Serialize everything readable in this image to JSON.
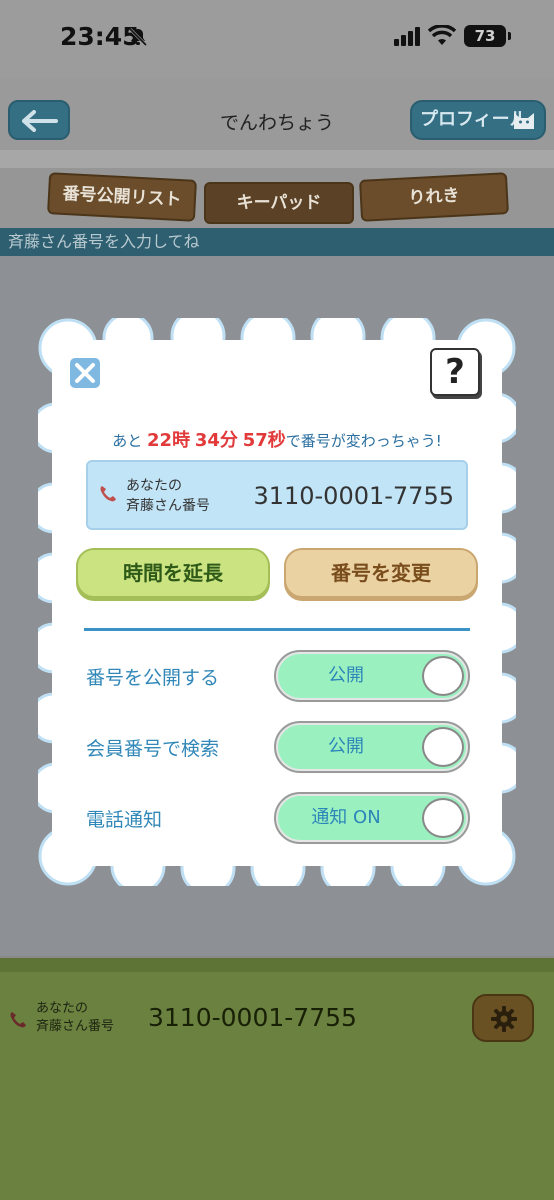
{
  "status_bar": {
    "time": "23:45",
    "battery": "73"
  },
  "header": {
    "title": "でんわちょう",
    "profile_button": "プロフィール"
  },
  "tabs": [
    {
      "label": "番号公開リスト"
    },
    {
      "label": "キーパッド"
    },
    {
      "label": "りれき"
    }
  ],
  "input_prompt": "斉藤さん番号を入力してね",
  "modal": {
    "countdown": {
      "prefix": "あと",
      "hours": "22",
      "hours_unit": "時",
      "minutes": "34",
      "minutes_unit": "分",
      "seconds": "57",
      "seconds_unit": "秒",
      "suffix": "で番号が変わっちゃう!"
    },
    "number": {
      "label_line1": "あなたの",
      "label_line2": "斉藤さん番号",
      "value": "3110-0001-7755"
    },
    "buttons": {
      "extend": "時間を延長",
      "change": "番号を変更"
    },
    "settings": [
      {
        "label": "番号を公開する",
        "toggle_text": "公開"
      },
      {
        "label": "会員番号で検索",
        "toggle_text": "公開"
      },
      {
        "label": "電話通知",
        "toggle_text": "通知 ON"
      }
    ]
  },
  "footer": {
    "label_line1": "あなたの",
    "label_line2": "斉藤さん番号",
    "value": "3110-0001-7755"
  },
  "colors": {
    "accent_blue": "#3188b8",
    "countdown_red": "#e23a3a",
    "toggle_on": "#9bf0c0"
  },
  "icons": [
    "back-arrow-icon",
    "cat-icon",
    "phone-icon",
    "keypad-icon",
    "list-icon",
    "close-icon",
    "help-icon",
    "gear-icon",
    "bell-muted-icon",
    "signal-icon",
    "wifi-icon"
  ]
}
